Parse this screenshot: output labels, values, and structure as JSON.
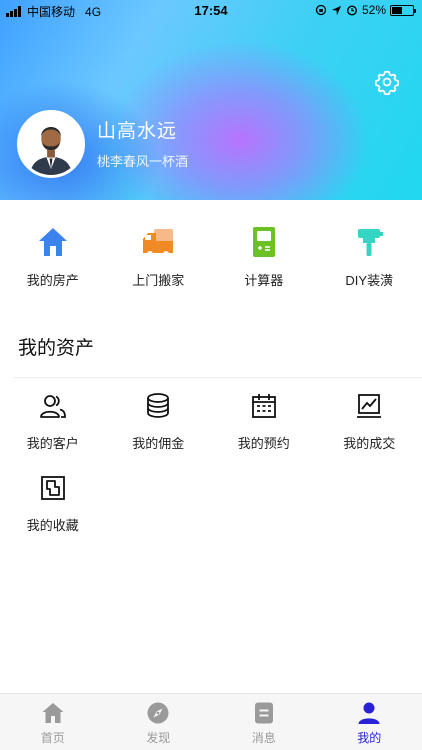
{
  "status_bar": {
    "carrier": "中国移动",
    "network": "4G",
    "time": "17:54",
    "battery": "52%",
    "battery_level": 0.52
  },
  "profile": {
    "name": "山高水远",
    "motto": "桃李春风一杯酒"
  },
  "quick_actions": [
    {
      "label": "我的房产",
      "icon": "house-icon"
    },
    {
      "label": "上门搬家",
      "icon": "truck-icon"
    },
    {
      "label": "计算器",
      "icon": "calculator-icon"
    },
    {
      "label": "DIY装潢",
      "icon": "paint-roller-icon"
    }
  ],
  "assets": {
    "title": "我的资产",
    "items": [
      {
        "label": "我的客户",
        "icon": "customers-icon"
      },
      {
        "label": "我的佣金",
        "icon": "coins-icon"
      },
      {
        "label": "我的预约",
        "icon": "calendar-icon"
      },
      {
        "label": "我的成交",
        "icon": "deal-chart-icon"
      },
      {
        "label": "我的收藏",
        "icon": "favorites-icon"
      }
    ]
  },
  "tabbar": [
    {
      "label": "首页",
      "icon": "home-icon",
      "active": false
    },
    {
      "label": "发现",
      "icon": "compass-icon",
      "active": false
    },
    {
      "label": "消息",
      "icon": "message-icon",
      "active": false
    },
    {
      "label": "我的",
      "icon": "user-icon",
      "active": true
    }
  ],
  "colors": {
    "active_tab": "#2a22d8",
    "inactive_tab": "#9a9a9a"
  }
}
